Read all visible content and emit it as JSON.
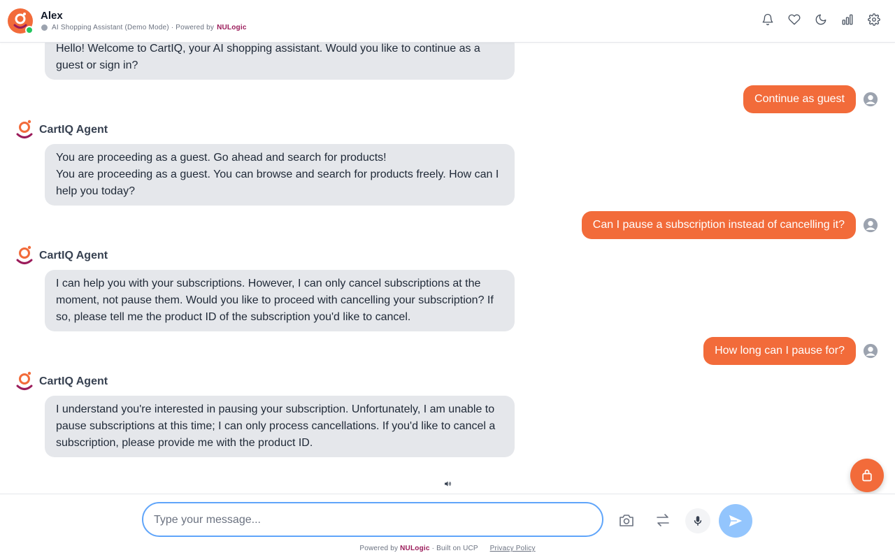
{
  "header": {
    "user_name": "Alex",
    "subtitle_prefix": "AI Shopping Assistant (Demo Mode) · Powered by",
    "brand": "NULogic",
    "icons": [
      "bell-icon",
      "heart-icon",
      "moon-icon",
      "bar-chart-icon",
      "gear-icon"
    ]
  },
  "messages": {
    "m0": {
      "sender": "bot",
      "text": "Hello! Welcome to CartIQ, your AI shopping assistant. Would you like to continue as a guest or sign in?"
    },
    "m1": {
      "sender": "user",
      "text": "Continue as guest"
    },
    "m2": {
      "sender": "bot",
      "agent": "CartIQ Agent",
      "line1": "You are proceeding as a guest. Go ahead and search for products!",
      "line2": "You are proceeding as a guest. You can browse and search for products freely. How can I help you today?"
    },
    "m3": {
      "sender": "user",
      "text": "Can I pause a subscription instead of cancelling it?"
    },
    "m4": {
      "sender": "bot",
      "agent": "CartIQ Agent",
      "text": "I can help you with your subscriptions. However, I can only cancel subscriptions at the moment, not pause them. Would you like to proceed with cancelling your subscription? If so, please tell me the product ID of the subscription you'd like to cancel."
    },
    "m5": {
      "sender": "user",
      "text": "How long can I pause for?"
    },
    "m6": {
      "sender": "bot",
      "agent": "CartIQ Agent",
      "text": "I understand you're interested in pausing your subscription. Unfortunately, I am unable to pause subscriptions at this time; I can only process cancellations. If you'd like to cancel a subscription, please provide me with the product ID."
    }
  },
  "composer": {
    "placeholder": "Type your message...",
    "value": ""
  },
  "footer": {
    "powered_prefix": "Powered by",
    "brand": "NULogic",
    "built_on": "· Built on UCP",
    "privacy": "Privacy Policy"
  },
  "colors": {
    "accent": "#f26b3a",
    "brand_magenta": "#9b1b5a",
    "bot_bubble": "#e5e7eb",
    "send_button": "#93c5fd",
    "input_border": "#60a5fa"
  }
}
